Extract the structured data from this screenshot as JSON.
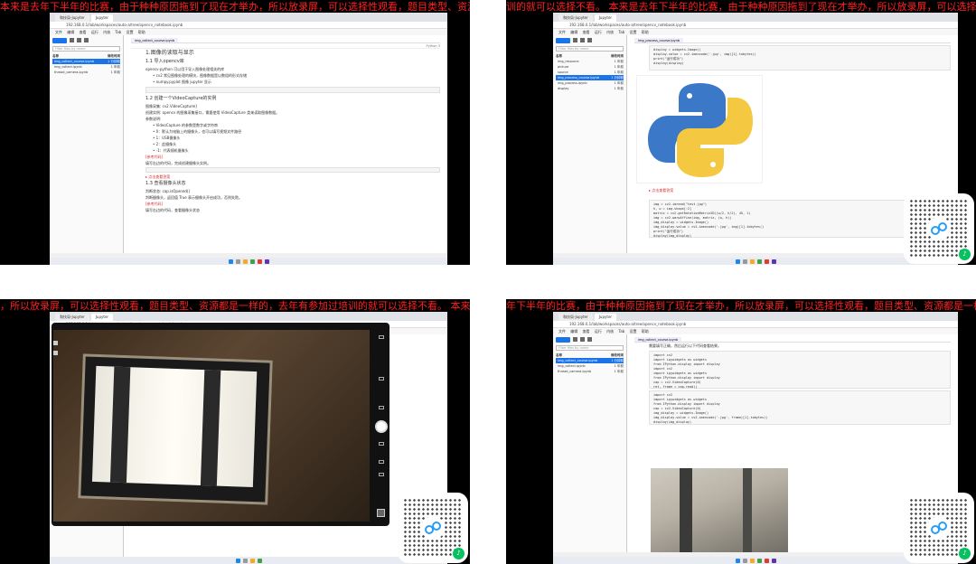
{
  "marquee_text": {
    "q1": "本来是去年下半年的比赛，由于种种原因拖到了现在才举办，所以放录屏，可以选择性观看，题目类型、资源都是一样的，去年有参加过培训的就可以选择不看。",
    "q2": "训的就可以选择不看。 本来是去年下半年的比赛，由于种种原因拖到了现在才举办，所以放录屏，可以选择性观看",
    "q3": "，所以放录屏，可以选择性观看，题目类型、资源都是一样的，去年有参加过培训的就可以选择不看。 本来是去",
    "q4": "年下半年的比赛，由于种种原因拖到了现在才举办，所以放录屏，可以选择性观看，题目类型、资源都是一样的，去"
  },
  "browser": {
    "tabs": [
      "和技局-Jupyter",
      "Jupyter"
    ],
    "address": "192.168.0.1/lab/workspaces/auto-a/tree/opencv_notebook.ipynb",
    "menu": [
      "文件",
      "编辑",
      "查看",
      "运行",
      "内核",
      "Tab",
      "设置",
      "帮助"
    ]
  },
  "sidebar": {
    "search_placeholder": "Filter files by name",
    "header_name": "名称",
    "header_modified": "修改时间",
    "q1_files": [
      {
        "name": "img_collect_course.ipynb",
        "time": "1 分钟前",
        "selected": true
      },
      {
        "name": "img_collect.ipynb",
        "time": "1 年前",
        "selected": false
      },
      {
        "name": "thread_camera.ipynb",
        "time": "1 年前",
        "selected": false
      }
    ],
    "q2_files": [
      {
        "name": "img_resource",
        "time": "1 年前",
        "selected": false
      },
      {
        "name": "picture",
        "time": "1 年前",
        "selected": false
      },
      {
        "name": "source",
        "time": "1 年前",
        "selected": false
      },
      {
        "name": "img_process_course.ipynb",
        "time": "1 分钟前",
        "selected": true
      },
      {
        "name": "img_process.ipynb",
        "time": "1 年前",
        "selected": false
      },
      {
        "name": "display",
        "time": "1 年前",
        "selected": false
      }
    ],
    "q4_files": [
      {
        "name": "img_collect_course.ipynb",
        "time": "1 分钟前",
        "selected": true
      },
      {
        "name": "img_collect.ipynb",
        "time": "1 年前",
        "selected": false
      },
      {
        "name": "thread_camera.ipynb",
        "time": "1 年前",
        "selected": false
      }
    ]
  },
  "notebook_q1": {
    "tab": "img_collect_course.ipynb",
    "kernel": "Python 3",
    "h1": "1.图像的读取与显示",
    "h2a": "1.1 导入opencv库",
    "p1": "opencv-python 可以用于导入图像处理相关的库",
    "b1": "• cv2 常见图像处理的模块，图像数据是以数组的形式存储",
    "b2": "• numpy.pyplot 图像 jupyter 显示",
    "h2b": "1.2 创建一个VideoCapture的实例",
    "p2": "图像采集: cv2.VideoCapture()",
    "p3": "创建实例: opencv 的图像采集接口，需要使用 VideoCapture 类来读取图像数据。",
    "p4": "参数说明:",
    "b3": "• VideoCapture 的参数是数字或字符串",
    "b4": "• 0：默认为电脑上的摄像头，也可以填写视频文件路径",
    "b5": "• 1：USB摄像头",
    "b6": "• 2：此摄像头",
    "b7": "• -1：代表随机摄像头",
    "red1": "[参考代码]",
    "p5": "填写右边的代码，完成创建摄像头实例。",
    "link": "▸ 点击查看答案",
    "h2c": "1.3 查看摄像头状态",
    "p6": "判断状态: cap.isOpened()",
    "p7": "判断摄像头，返回值 True 表示摄像头开启成功，否则失败。",
    "red2": "[参考代码]",
    "p8": "填写右边的代码，查看摄像头状态"
  },
  "notebook_q2": {
    "tab": "img_process_course.ipynb",
    "link": "▸ 点击查看答案",
    "code_top": "display = widgets.Image()\ndisplay.value = cv2.imencode('.jpg', img)[1].tobytes()\nprint(\"运行成功\")\ndisplay(display)",
    "code_bottom": "img = cv2.imread(\"test.jpg\")\nh, w = img.shape[:2]\nmatrix = cv2.getRotationMatrix2D((w/2, h/2), 45, 1)\nimg = cv2.warpAffine(img, matrix, (w, h))\nimg_display = widgets.Image()\nimg_display.value = cv2.imencode('.jpg', img)[1].tobytes()\nprint(\"运行成功\")\ndisplay(img_display)"
  },
  "notebook_q4": {
    "tab": "img_collect_course.ipynb",
    "p1": "需要填写正确，然后运行以下代码查看结果。",
    "code1": "import cv2\nimport ipywidgets as widgets\nfrom IPython.display import display\nimport cv2\nimport ipywidgets as widgets\nfrom IPython.display import display\ncap = cv2.VideoCapture(0)\nret, frame = cap.read()",
    "code2": "import cv2\nimport ipywidgets as widgets\nfrom IPython.display import display\ncap = cv2.VideoCapture(0)\nimg_display = widgets.Image()\nimg_display.value = cv2.imencode('.jpg', frame)[1].tobytes()\ndisplay(img_display)"
  },
  "colors": {
    "marquee": "#ff2020",
    "accent": "#1a73e8",
    "python_blue": "#3c78c8",
    "python_yellow": "#f5c842",
    "qr_badge": "#07c160"
  }
}
